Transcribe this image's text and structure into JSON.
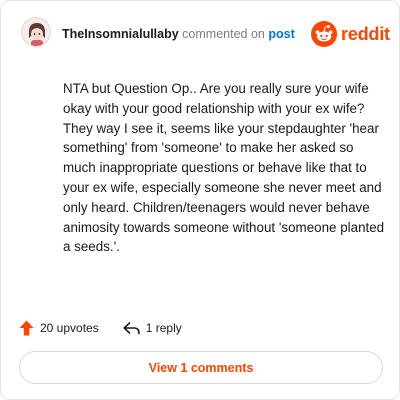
{
  "comment": {
    "username": "TheInsomnialullaby",
    "commented_text": "commented on",
    "post_link": "post",
    "body": "NTA but Question Op.. Are you really sure your wife okay with your good relationship with your ex wife? They way I see it, seems like your stepdaughter 'hear something' from 'someone' to make her asked so much inappropriate questions or behave like that to your ex wife, especially someone she never meet and only heard. Children/teenagers would never behave animosity towards someone without 'someone planted a seeds.'."
  },
  "brand": {
    "name": "reddit",
    "color": "#ff4500",
    "icon": "reddit-snoo-icon"
  },
  "footer": {
    "upvotes_label": "20 upvotes",
    "reply_label": "1 reply",
    "upvote_icon": "upvote-arrow-icon",
    "reply_icon": "reply-arrow-icon",
    "upvote_color": "#ff4500"
  },
  "view_button": {
    "label": "View 1 comments"
  }
}
